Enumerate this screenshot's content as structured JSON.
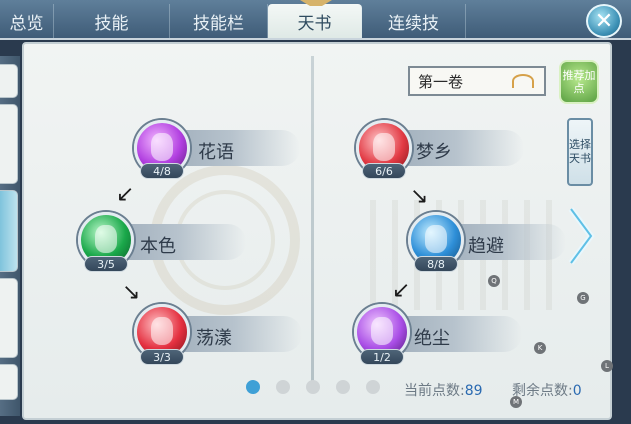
{
  "tabs": [
    {
      "label": "总览",
      "active": false
    },
    {
      "label": "技能",
      "active": false
    },
    {
      "label": "技能栏",
      "active": false
    },
    {
      "label": "天书",
      "active": true
    },
    {
      "label": "连续技",
      "active": false
    }
  ],
  "close_label": "✕",
  "volume": {
    "label": "第一卷"
  },
  "buttons": {
    "recommend": "推荐加点",
    "choose_book": "选择天书"
  },
  "skills_left": [
    {
      "name": "花语",
      "count": "4/8",
      "color": "#b13fe0"
    },
    {
      "name": "本色",
      "count": "3/5",
      "color": "#1aa84a"
    },
    {
      "name": "荡漾",
      "count": "3/3",
      "color": "#e43040"
    }
  ],
  "skills_right": [
    {
      "name": "梦乡",
      "count": "6/6",
      "color": "#e23a44"
    },
    {
      "name": "趋避",
      "count": "8/8",
      "color": "#2e8fd8"
    },
    {
      "name": "绝尘",
      "count": "1/2",
      "color": "#a94ee6"
    }
  ],
  "pager": {
    "pages": 5,
    "current": 1
  },
  "points": {
    "current_label": "当前点数:",
    "current_value": "89",
    "remain_label": "剩余点数:",
    "remain_value": "0"
  },
  "key_hints": [
    "Q",
    "G",
    "K",
    "L",
    "M"
  ]
}
